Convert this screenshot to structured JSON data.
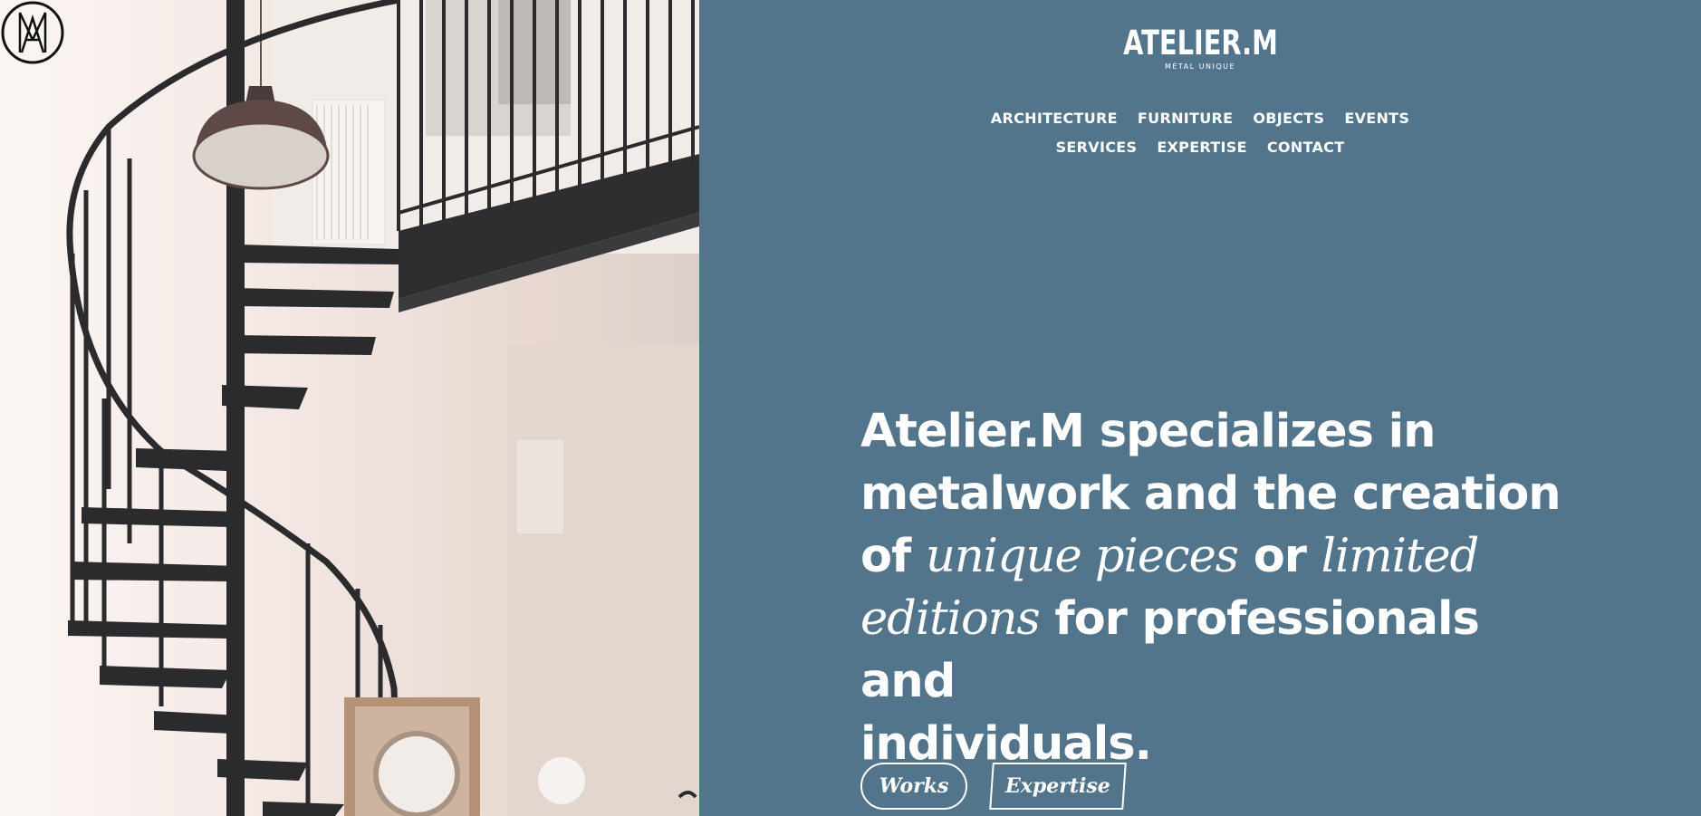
{
  "brand": {
    "name": "ATELIER.M",
    "tagline": "MÉTAL UNIQUE",
    "mark_icon": "am-monogram-icon"
  },
  "nav": {
    "row1": [
      "ARCHITECTURE",
      "FURNITURE",
      "OBJECTS",
      "EVENTS"
    ],
    "row2": [
      "SERVICES",
      "EXPERTISE",
      "CONTACT"
    ]
  },
  "hero": {
    "line1": "Atelier.M specializes in",
    "line2": "metalwork and the creation",
    "line3_a": "of ",
    "line3_b": "unique pieces",
    "line3_c": " or ",
    "line3_d": "limited",
    "line4_a": "editions",
    "line4_b": " for professionals and",
    "line5": "individuals."
  },
  "buttons": {
    "works": "Works",
    "expertise": "Expertise"
  },
  "colors": {
    "panel": "#52758b",
    "text": "#ffffff",
    "stair": "#2b2a2c"
  }
}
